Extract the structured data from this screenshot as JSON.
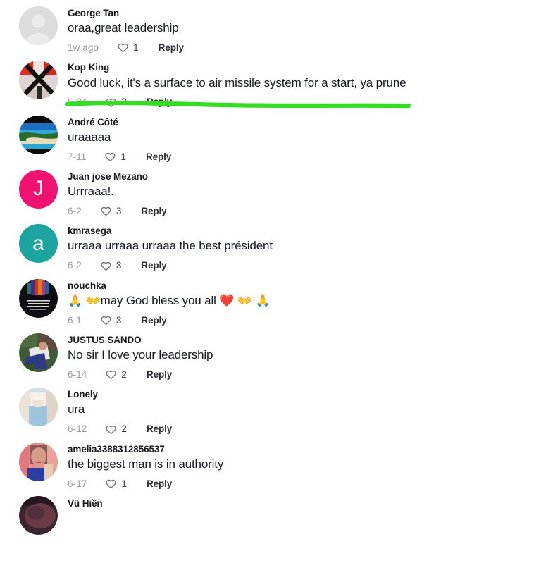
{
  "app": {
    "type": "social-media-comment-thread",
    "background_color": "#ffffff"
  },
  "annotation": {
    "type": "hand-drawn-underline",
    "color": "#33dd22",
    "target_comment_index": 1,
    "target_text": "Good luck, it's a surface to air missile system for a start, ya prune"
  },
  "labels": {
    "reply": "Reply",
    "heart_icon": "heart-outline-icon"
  },
  "comments": [
    {
      "author": "George Tan",
      "text": "oraa,great leadership",
      "date": "1w ago",
      "likes": "1",
      "reply": "Reply",
      "avatar": {
        "kind": "default-person",
        "color": "#d6d6d6"
      }
    },
    {
      "author": "Kop King",
      "text": "Good luck, it's a surface to air missile system for a start, ya prune",
      "date": "6-24",
      "likes": "3",
      "reply": "Reply",
      "avatar": {
        "kind": "photo-x-mark",
        "color": "#e03028"
      }
    },
    {
      "author": "André Côté",
      "text": "uraaaaa",
      "date": "7-11",
      "likes": "1",
      "reply": "Reply",
      "avatar": {
        "kind": "photo-beach",
        "color": "#1f7fc6"
      }
    },
    {
      "author": "Juan jose Mezano",
      "text": "Urrraaa!.",
      "date": "6-2",
      "likes": "3",
      "reply": "Reply",
      "avatar": {
        "kind": "letter",
        "letter": "J",
        "color": "#ef1270"
      }
    },
    {
      "author": "kmrasega",
      "text": "urraaa urraaa urraaa the best président",
      "date": "6-2",
      "likes": "3",
      "reply": "Reply",
      "avatar": {
        "kind": "letter",
        "letter": "a",
        "color": "#1ba4a0"
      }
    },
    {
      "author": "nouchka",
      "text": "🙏 👐may God bless you all ❤️ 👐 🙏",
      "date": "6-1",
      "likes": "3",
      "reply": "Reply",
      "avatar": {
        "kind": "photo-dark-gradient",
        "color": "#151515"
      }
    },
    {
      "author": "JUSTUS SANDO",
      "text": "No sir I love your leadership",
      "date": "6-14",
      "likes": "2",
      "reply": "Reply",
      "avatar": {
        "kind": "photo-outdoor",
        "color": "#4b6340"
      }
    },
    {
      "author": "Lonely",
      "text": "ura",
      "date": "6-12",
      "likes": "2",
      "reply": "Reply",
      "avatar": {
        "kind": "photo-light-blue",
        "color": "#aac7dc"
      }
    },
    {
      "author": "amelia3388312856537",
      "text": "the biggest man is in authority",
      "date": "6-17",
      "likes": "1",
      "reply": "Reply",
      "avatar": {
        "kind": "photo-portrait-pink",
        "color": "#d8737c"
      }
    },
    {
      "author": "Vũ Hiền",
      "text": "",
      "date": "",
      "likes": "",
      "reply": "",
      "avatar": {
        "kind": "photo-dark-maroon",
        "color": "#4b2b33"
      },
      "clipped": true
    }
  ]
}
